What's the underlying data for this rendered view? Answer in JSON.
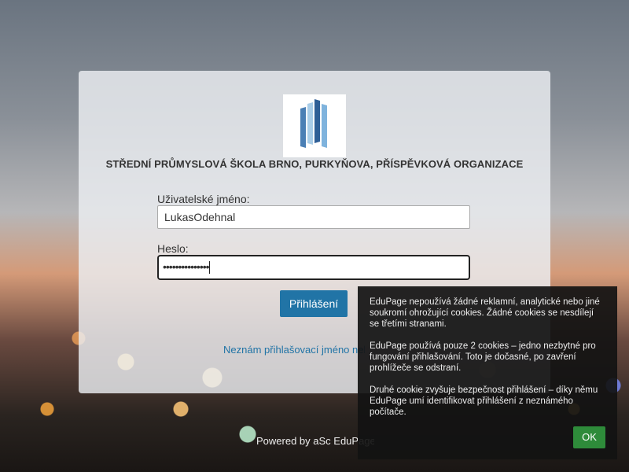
{
  "organization": {
    "name": "STŘEDNÍ PRŮMYSLOVÁ ŠKOLA BRNO, PURKYŇOVA, PŘÍSPĚVKOVÁ ORGANIZACE"
  },
  "login_form": {
    "username_label": "Uživatelské jméno:",
    "username_value": "LukasOdehnal",
    "password_label": "Heslo:",
    "password_value": "•••••••••••••••",
    "submit_label": "Přihlášení",
    "forgot_link": "Neznám přihlašovací jméno nebo heslo"
  },
  "footer": {
    "powered_by": "Powered by aSc EduPage"
  },
  "cookie_notice": {
    "paragraph_1": "EduPage nepoužívá žádné reklamní, analytické nebo jiné soukromí ohrožující cookies. Žádné cookies se nesdílejí se třetími stranami.",
    "paragraph_2": "EduPage používá pouze 2 cookies – jedno nezbytné pro fungování přihlašování. Toto je dočasné, po zavření prohlížeče se odstraní.",
    "paragraph_3": "Druhé cookie zvyšuje bezpečnost přihlášení – díky němu EduPage umí identifikovat přihlášení z neznámého počítače.",
    "ok_label": "OK"
  },
  "colors": {
    "primary": "#2174a6",
    "ok": "#2e8b3a",
    "logo_blue": "#4a7fb5"
  },
  "icons": {
    "logo": "school-logo-icon"
  }
}
